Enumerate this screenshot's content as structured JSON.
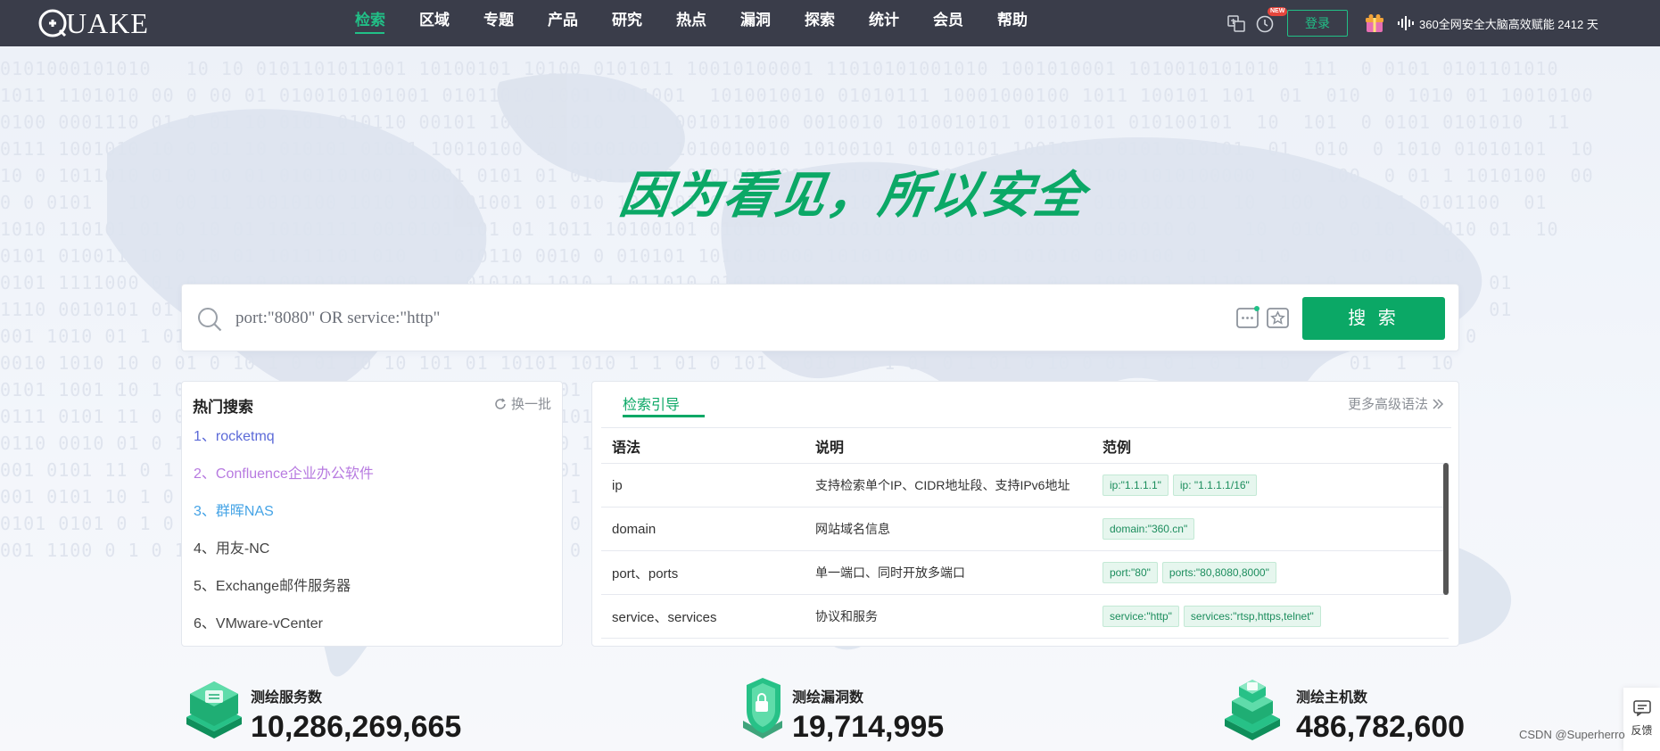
{
  "header": {
    "logo_text": "UAKE",
    "nav": [
      "检索",
      "区域",
      "专题",
      "产品",
      "研究",
      "热点",
      "漏洞",
      "探索",
      "统计",
      "会员",
      "帮助"
    ],
    "new_badge": "NEW",
    "login": "登录",
    "runtime_text": "360全网安全大脑高效赋能 2412 天"
  },
  "hero": {
    "slogan": "因为看见，所以安全"
  },
  "search": {
    "placeholder": "port:\"8080\" OR service:\"http\"",
    "button": "搜 索"
  },
  "hot": {
    "title": "热门搜索",
    "refresh": "换一批",
    "items": [
      "1、rocketmq",
      "2、Confluence企业办公软件",
      "3、群晖NAS",
      "4、用友-NC",
      "5、Exchange邮件服务器",
      "6、VMware-vCenter"
    ]
  },
  "guide": {
    "tab": "检索引导",
    "more": "更多高级语法",
    "headers": [
      "语法",
      "说明",
      "范例"
    ],
    "rows": [
      {
        "syntax": "ip",
        "desc": "支持检索单个IP、CIDR地址段、支持IPv6地址",
        "examples": [
          "ip:\"1.1.1.1\"",
          "ip: \"1.1.1.1/16\""
        ]
      },
      {
        "syntax": "domain",
        "desc": "网站域名信息",
        "examples": [
          "domain:\"360.cn\""
        ]
      },
      {
        "syntax": "port、ports",
        "desc": "单一端口、同时开放多端口",
        "examples": [
          "port:\"80\"",
          "ports:\"80,8080,8000\""
        ]
      },
      {
        "syntax": "service、services",
        "desc": "协议和服务",
        "examples": [
          "service:\"http\"",
          "services:\"rtsp,https,telnet\""
        ]
      }
    ]
  },
  "stats": [
    {
      "label": "测绘服务数",
      "value": "10,286,269,665",
      "icon": "server-stack-icon"
    },
    {
      "label": "测绘漏洞数",
      "value": "19,714,995",
      "icon": "shield-vuln-icon"
    },
    {
      "label": "测绘主机数",
      "value": "486,782,600",
      "icon": "host-stack-icon"
    }
  ],
  "feedback": {
    "label": "反馈"
  },
  "watermark": "CSDN @Superherro",
  "colors": {
    "brand_green": "#0ba866",
    "accent_green": "#21c087",
    "header_bg": "#3a3d4a"
  }
}
